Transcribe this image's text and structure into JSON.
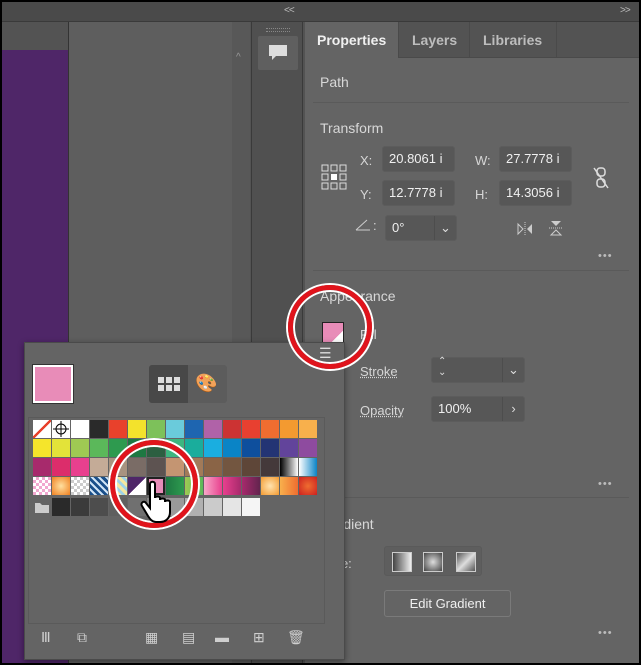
{
  "window": {
    "collapse_left": "<<",
    "collapse_right": ">>"
  },
  "tabs": [
    {
      "label": "Properties",
      "active": true
    },
    {
      "label": "Layers",
      "active": false
    },
    {
      "label": "Libraries",
      "active": false
    }
  ],
  "properties": {
    "selection_type": "Path",
    "transform": {
      "title": "Transform",
      "x_label": "X:",
      "x_value": "20.8061 i",
      "y_label": "Y:",
      "y_value": "12.7778 i",
      "w_label": "W:",
      "w_value": "27.7778 i",
      "h_label": "H:",
      "h_value": "14.3056 i",
      "angle_value": "0°"
    },
    "appearance": {
      "title": "Appearance",
      "fill_label": "Fill",
      "fill_color": "#e88cb8",
      "stroke_label": "Stroke",
      "opacity_label": "Opacity",
      "opacity_value": "100%"
    },
    "gradient": {
      "title": "Gradient",
      "type_label": "Type:",
      "edit_button": "Edit Gradient"
    },
    "more_label": "•••"
  },
  "swatches_popup": {
    "current_fill": "#e88cb8",
    "rows": [
      [
        "none",
        "registration",
        "#ffffff",
        "#2a2a2a",
        "#e8412c",
        "#f3e22c",
        "#7dc15a",
        "#6acbdb",
        "#1e65b0",
        "#b062a8",
        "#cc3333",
        "#e84030",
        "#ef6d30",
        "#f39a30",
        "#f8b04c"
      ],
      [
        "#f5e52b",
        "#e3e339",
        "#9fc953",
        "#5bb85a",
        "#2e9a4f",
        "#1e7842",
        "#2c5f41",
        "#3db680",
        "#1aad9c",
        "#1aaee0",
        "#0a84c6",
        "#0e4f9d",
        "#233474",
        "#62449b",
        "#8e4b9f"
      ],
      [
        "#a72a6c",
        "#dc2d6b",
        "#e8408e",
        "#c4ab97",
        "#a89380",
        "#7a6c66",
        "#5d5351",
        "#c49572",
        "#a27a58",
        "#8a6446",
        "#735640",
        "#5e4638",
        "#44393a",
        "linear-gradient(90deg,#000,#fff)",
        "linear-gradient(90deg,#fff,#0a84c6)"
      ],
      [
        "repeating-conic-gradient(#f1a7cf 0 25%,#fff 0 50%) 0 0/6px 6px",
        "radial-gradient(#ffe0a0,#f08020)",
        "repeating-conic-gradient(#ccc 0 25%,#fff 0 50%) 0 0/6px 6px",
        "repeating-linear-gradient(45deg,#1a4f8a 0 3px,#cfe3f5 3px 5px)",
        "repeating-linear-gradient(45deg,#f5e7a0 0 3px,#9fd3e8 3px 6px)",
        "linear-gradient(135deg,#4f2668 50%,#fff 50%)",
        "#e88cb8",
        "linear-gradient(90deg,#1e7842,#2e9a4f)",
        "linear-gradient(90deg,#9fc953,#5bb85a)",
        "linear-gradient(90deg,#f7a6c8,#e8408e)",
        "linear-gradient(90deg,#e8408e,#a72a6c)",
        "linear-gradient(90deg,#a72a6c,#62244e)",
        "radial-gradient(#ffe3b0,#f39a30)",
        "linear-gradient(90deg,#f8b04c,#ef6d30)",
        "radial-gradient(#ef6d30,#cc2020)"
      ],
      [
        "folder",
        "#2a2a2a",
        "#3b3b3b",
        "#4d4d4d",
        "#5f5f5f",
        "#707070",
        "#858585",
        "#9a9a9a",
        "#b0b0b0",
        "#cbcbcb",
        "#e5e5e5",
        "#f5f5f5"
      ]
    ],
    "selected": [
      3,
      6
    ]
  },
  "colors": {
    "highlight_ring": "#e0141c",
    "canvas_artwork": "#4f2668"
  }
}
